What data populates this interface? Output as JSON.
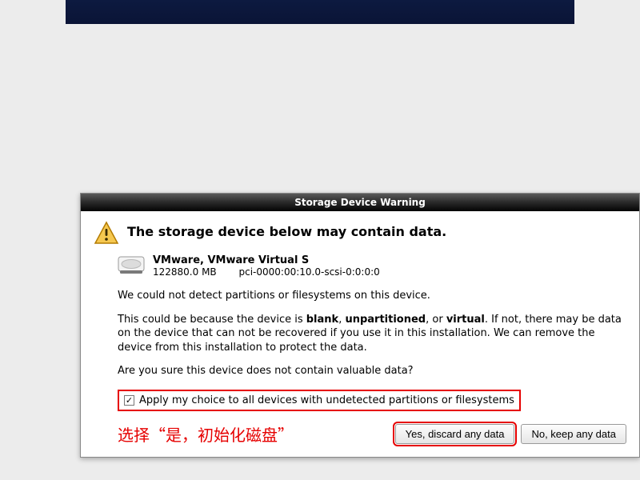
{
  "dialog": {
    "title": "Storage Device Warning",
    "heading": "The storage device below may contain data.",
    "device": {
      "name": "VMware, VMware Virtual S",
      "size": "122880.0 MB",
      "path": "pci-0000:00:10.0-scsi-0:0:0:0"
    },
    "para1": "We could not detect partitions or filesystems on this device.",
    "para2_pre": "This could be because the device is ",
    "para2_b1": "blank",
    "para2_mid1": ", ",
    "para2_b2": "unpartitioned",
    "para2_mid2": ", or ",
    "para2_b3": "virtual",
    "para2_post": ". If not, there may be data on the device that can not be recovered if you use it in this installation. We can remove the device from this installation to protect the data.",
    "para3": "Are you sure this device does not contain valuable data?",
    "checkbox_label": "Apply my choice to all devices with undetected partitions or filesystems",
    "checkbox_checked": true,
    "annotation": "选择“是，初始化磁盘”",
    "buttons": {
      "yes": "Yes, discard any data",
      "no": "No, keep any data"
    }
  }
}
